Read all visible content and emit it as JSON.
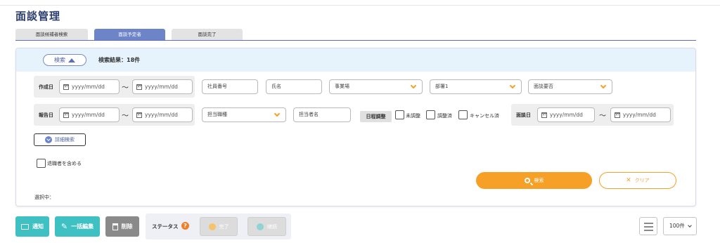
{
  "page": {
    "title": "面談管理"
  },
  "tabs": [
    {
      "label": "面談候補者検索"
    },
    {
      "label": "面談予定者"
    },
    {
      "label": "面談完了"
    }
  ],
  "search": {
    "toggle_label": "検索",
    "result_text": "検索結果：18件",
    "row1": {
      "label": "作成日",
      "date_from_placeholder": "yyyy/mm/dd",
      "tilde": "～",
      "date_to_placeholder": "yyyy/mm/dd",
      "employee_no_placeholder": "社員番号",
      "name_placeholder": "氏名",
      "office_select": "事業場",
      "dept_select": "部署1",
      "necessity_select": "面談要否"
    },
    "row2": {
      "label": "報告日",
      "date_from_placeholder": "yyyy/mm/dd",
      "tilde": "～",
      "date_to_placeholder": "yyyy/mm/dd",
      "job_select": "担当職種",
      "staff_name_placeholder": "担当者名",
      "schedule_label": "日程調整",
      "checkbox_unadjusted": "未調整",
      "checkbox_adjusted": "調整済",
      "checkbox_cancelled": "キャンセル済",
      "interview_date_label": "面談日",
      "interview_from_placeholder": "yyyy/mm/dd",
      "interview_tilde": "～",
      "interview_to_placeholder": "yyyy/mm/dd"
    },
    "detail_button": "詳細検索",
    "include_retired_label": "退職者を含める",
    "search_button": "検索",
    "clear_button": "クリア",
    "selected_label": "選択中："
  },
  "actions": {
    "notify": "通知",
    "bulk_edit": "一括編集",
    "delete": "削除",
    "status_label": "ステータス",
    "status_help": "?",
    "complete": "完了",
    "continue": "継続",
    "per_page": "100件"
  },
  "colors": {
    "accent_orange": "#f6a027",
    "tab_active": "#6d84c8",
    "teal": "#3fc0c2",
    "title": "#2a3d6b"
  }
}
